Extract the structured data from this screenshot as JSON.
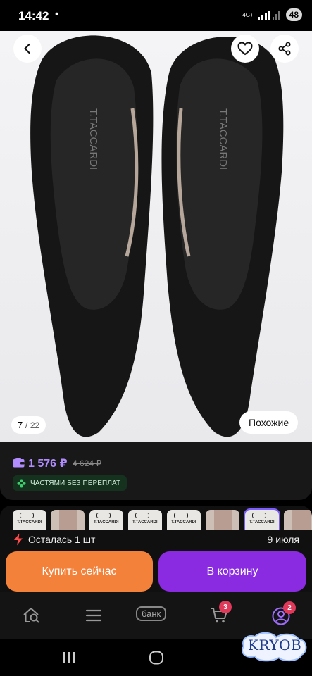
{
  "status_bar": {
    "time": "14:42",
    "dot": "•",
    "network": "4G+",
    "battery": "48"
  },
  "gallery": {
    "brand_on_insole": "T.TACCARDI",
    "counter_current": "7",
    "counter_separator": "/",
    "counter_total": "22",
    "similar_label": "Похожие"
  },
  "price": {
    "current": "1 576 ₽",
    "old": "4 624 ₽",
    "installments_label": "ЧАСТЯМИ БЕЗ ПЕРЕПЛАТ",
    "current_color": "#b08cff"
  },
  "thumbnails": {
    "brand": "T.TACCARDI",
    "selected_index": 7
  },
  "stock": {
    "label": "Осталась 1 шт",
    "delivery_date": "9 июля"
  },
  "actions": {
    "buy_now_label": "Купить сейчас",
    "add_to_cart_label": "В корзину",
    "buy_now_color": "#f4813a",
    "add_to_cart_color": "#8a2be2"
  },
  "bottom_nav": {
    "bank_label": "банк",
    "cart_badge": "3",
    "profile_badge": "2"
  },
  "watermark": "KRYOB"
}
